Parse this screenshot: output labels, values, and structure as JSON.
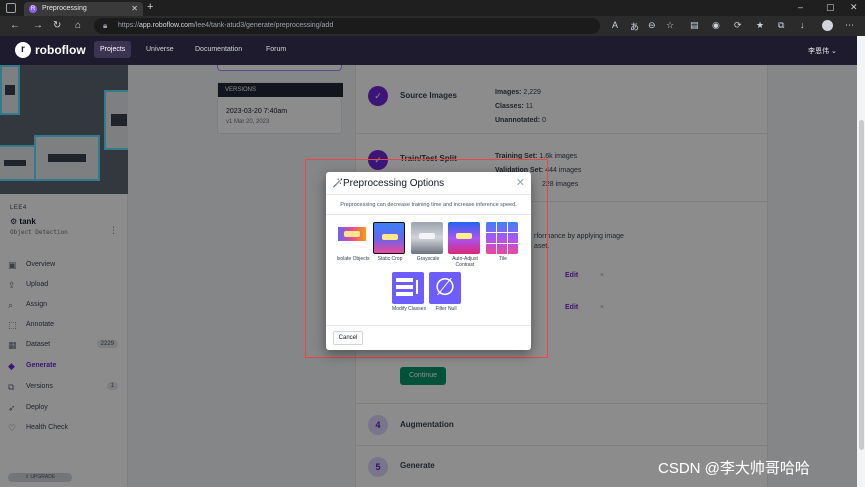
{
  "browser": {
    "tab_title": "Preprocessing",
    "url_prefix": "https://",
    "url_host": "app.roboflow.com",
    "url_path": "/lee4/tank-atud3/generate/preprocessing/add",
    "icons": [
      "workspaces-icon",
      "back-icon",
      "forward-icon",
      "refresh-icon",
      "home-icon",
      "lock-icon"
    ]
  },
  "app": {
    "logo": "roboflow",
    "nav": [
      "Projects",
      "Universe",
      "Documentation",
      "Forum"
    ],
    "user": "李恩伟"
  },
  "sidebar": {
    "workspace": "LEE4",
    "project_name": "tank",
    "project_type": "Object Detection",
    "items": [
      {
        "label": "Overview",
        "icon": "overview-icon"
      },
      {
        "label": "Upload",
        "icon": "upload-icon"
      },
      {
        "label": "Assign",
        "icon": "assign-icon"
      },
      {
        "label": "Annotate",
        "icon": "annotate-icon"
      },
      {
        "label": "Dataset",
        "icon": "dataset-icon",
        "count": "2229"
      },
      {
        "label": "Generate",
        "icon": "generate-icon"
      },
      {
        "label": "Versions",
        "icon": "versions-icon",
        "count": "1"
      },
      {
        "label": "Deploy",
        "icon": "deploy-icon"
      },
      {
        "label": "Health Check",
        "icon": "health-check-icon"
      }
    ],
    "upgrade": "UPGRADE"
  },
  "versions": {
    "header": "VERSIONS",
    "date": "2023-03-20 7:40am",
    "sub": "v1 Mar 20, 2023"
  },
  "steps": {
    "source": {
      "title": "Source Images",
      "images_label": "Images:",
      "images_value": "2,229",
      "classes_label": "Classes:",
      "classes_value": "11",
      "unannotated_label": "Unannotated:",
      "unannotated_value": "0"
    },
    "split": {
      "title": "Train/Test Split",
      "train_label": "Training Set:",
      "train_value": "1.6k images",
      "valid_label": "Validation Set:",
      "valid_value": "444 images",
      "test_value": "228 images"
    },
    "preproc_text_1": "rformance by applying image",
    "preproc_text_2": "aset.",
    "edit": "Edit",
    "continue": "Continue",
    "augmentation_num": "4",
    "augmentation": "Augmentation",
    "generate_num": "5",
    "generate": "Generate"
  },
  "modal": {
    "title": "Preprocessing Options",
    "subtitle": "Preprocessing can decrease training time and increase inference speed.",
    "options": [
      {
        "label": "Isolate Objects"
      },
      {
        "label": "Static Crop"
      },
      {
        "label": "Grayscale"
      },
      {
        "label": "Auto-Adjust Contrast"
      },
      {
        "label": "Tile"
      },
      {
        "label": "Modify Classes"
      },
      {
        "label": "Filter Null"
      }
    ],
    "cancel": "Cancel"
  },
  "watermark": "CSDN @李大帅哥哈哈",
  "colors": {
    "accent": "#6d28d9",
    "continue": "#059669",
    "highlight": "#ef4444"
  }
}
